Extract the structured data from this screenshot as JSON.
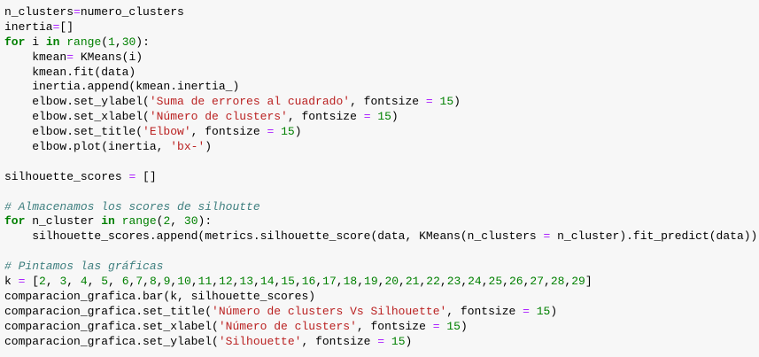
{
  "code_lines": [
    [
      [
        "tx",
        "n_clusters"
      ],
      [
        "op",
        "="
      ],
      [
        "tx",
        "numero_clusters"
      ]
    ],
    [
      [
        "tx",
        "inertia"
      ],
      [
        "op",
        "="
      ],
      [
        "tx",
        "[]"
      ]
    ],
    [
      [
        "kw",
        "for"
      ],
      [
        "tx",
        " i "
      ],
      [
        "kw",
        "in"
      ],
      [
        "tx",
        " "
      ],
      [
        "bi",
        "range"
      ],
      [
        "tx",
        "("
      ],
      [
        "num",
        "1"
      ],
      [
        "tx",
        ","
      ],
      [
        "num",
        "30"
      ],
      [
        "tx",
        "):"
      ]
    ],
    [
      [
        "tx",
        "    kmean"
      ],
      [
        "op",
        "="
      ],
      [
        "tx",
        " KMeans(i)"
      ]
    ],
    [
      [
        "tx",
        "    kmean.fit(data)"
      ]
    ],
    [
      [
        "tx",
        "    inertia.append(kmean.inertia_)"
      ]
    ],
    [
      [
        "tx",
        "    elbow.set_ylabel("
      ],
      [
        "str",
        "'Suma de errores al cuadrado'"
      ],
      [
        "tx",
        ", fontsize "
      ],
      [
        "op",
        "="
      ],
      [
        "tx",
        " "
      ],
      [
        "num",
        "15"
      ],
      [
        "tx",
        ")"
      ]
    ],
    [
      [
        "tx",
        "    elbow.set_xlabel("
      ],
      [
        "str",
        "'Número de clusters'"
      ],
      [
        "tx",
        ", fontsize "
      ],
      [
        "op",
        "="
      ],
      [
        "tx",
        " "
      ],
      [
        "num",
        "15"
      ],
      [
        "tx",
        ")"
      ]
    ],
    [
      [
        "tx",
        "    elbow.set_title("
      ],
      [
        "str",
        "'Elbow'"
      ],
      [
        "tx",
        ", fontsize "
      ],
      [
        "op",
        "="
      ],
      [
        "tx",
        " "
      ],
      [
        "num",
        "15"
      ],
      [
        "tx",
        ")"
      ]
    ],
    [
      [
        "tx",
        "    elbow.plot(inertia, "
      ],
      [
        "str",
        "'bx-'"
      ],
      [
        "tx",
        ")"
      ]
    ],
    [],
    [
      [
        "tx",
        "silhouette_scores "
      ],
      [
        "op",
        "="
      ],
      [
        "tx",
        " []"
      ]
    ],
    [],
    [
      [
        "cm",
        "# Almacenamos los scores de silhoutte"
      ]
    ],
    [
      [
        "kw",
        "for"
      ],
      [
        "tx",
        " n_cluster "
      ],
      [
        "kw",
        "in"
      ],
      [
        "tx",
        " "
      ],
      [
        "bi",
        "range"
      ],
      [
        "tx",
        "("
      ],
      [
        "num",
        "2"
      ],
      [
        "tx",
        ", "
      ],
      [
        "num",
        "30"
      ],
      [
        "tx",
        "):"
      ]
    ],
    [
      [
        "tx",
        "    silhouette_scores.append(metrics.silhouette_score(data, KMeans(n_clusters "
      ],
      [
        "op",
        "="
      ],
      [
        "tx",
        " n_cluster).fit_predict(data)))"
      ]
    ],
    [],
    [
      [
        "cm",
        "# Pintamos las gráficas"
      ]
    ],
    [
      [
        "tx",
        "k "
      ],
      [
        "op",
        "="
      ],
      [
        "tx",
        " ["
      ],
      [
        "num",
        "2"
      ],
      [
        "tx",
        ", "
      ],
      [
        "num",
        "3"
      ],
      [
        "tx",
        ", "
      ],
      [
        "num",
        "4"
      ],
      [
        "tx",
        ", "
      ],
      [
        "num",
        "5"
      ],
      [
        "tx",
        ", "
      ],
      [
        "num",
        "6"
      ],
      [
        "tx",
        ","
      ],
      [
        "num",
        "7"
      ],
      [
        "tx",
        ","
      ],
      [
        "num",
        "8"
      ],
      [
        "tx",
        ","
      ],
      [
        "num",
        "9"
      ],
      [
        "tx",
        ","
      ],
      [
        "num",
        "10"
      ],
      [
        "tx",
        ","
      ],
      [
        "num",
        "11"
      ],
      [
        "tx",
        ","
      ],
      [
        "num",
        "12"
      ],
      [
        "tx",
        ","
      ],
      [
        "num",
        "13"
      ],
      [
        "tx",
        ","
      ],
      [
        "num",
        "14"
      ],
      [
        "tx",
        ","
      ],
      [
        "num",
        "15"
      ],
      [
        "tx",
        ","
      ],
      [
        "num",
        "16"
      ],
      [
        "tx",
        ","
      ],
      [
        "num",
        "17"
      ],
      [
        "tx",
        ","
      ],
      [
        "num",
        "18"
      ],
      [
        "tx",
        ","
      ],
      [
        "num",
        "19"
      ],
      [
        "tx",
        ","
      ],
      [
        "num",
        "20"
      ],
      [
        "tx",
        ","
      ],
      [
        "num",
        "21"
      ],
      [
        "tx",
        ","
      ],
      [
        "num",
        "22"
      ],
      [
        "tx",
        ","
      ],
      [
        "num",
        "23"
      ],
      [
        "tx",
        ","
      ],
      [
        "num",
        "24"
      ],
      [
        "tx",
        ","
      ],
      [
        "num",
        "25"
      ],
      [
        "tx",
        ","
      ],
      [
        "num",
        "26"
      ],
      [
        "tx",
        ","
      ],
      [
        "num",
        "27"
      ],
      [
        "tx",
        ","
      ],
      [
        "num",
        "28"
      ],
      [
        "tx",
        ","
      ],
      [
        "num",
        "29"
      ],
      [
        "tx",
        "]"
      ]
    ],
    [
      [
        "tx",
        "comparacion_grafica.bar(k, silhouette_scores)"
      ]
    ],
    [
      [
        "tx",
        "comparacion_grafica.set_title("
      ],
      [
        "str",
        "'Número de clusters Vs Silhouette'"
      ],
      [
        "tx",
        ", fontsize "
      ],
      [
        "op",
        "="
      ],
      [
        "tx",
        " "
      ],
      [
        "num",
        "15"
      ],
      [
        "tx",
        ")"
      ]
    ],
    [
      [
        "tx",
        "comparacion_grafica.set_xlabel("
      ],
      [
        "str",
        "'Número de clusters'"
      ],
      [
        "tx",
        ", fontsize "
      ],
      [
        "op",
        "="
      ],
      [
        "tx",
        " "
      ],
      [
        "num",
        "15"
      ],
      [
        "tx",
        ")"
      ]
    ],
    [
      [
        "tx",
        "comparacion_grafica.set_ylabel("
      ],
      [
        "str",
        "'Silhouette'"
      ],
      [
        "tx",
        ", fontsize "
      ],
      [
        "op",
        "="
      ],
      [
        "tx",
        " "
      ],
      [
        "num",
        "15"
      ],
      [
        "tx",
        ")"
      ]
    ]
  ],
  "colors": {
    "background": "#f7f7f7",
    "keyword": "#008000",
    "number": "#008000",
    "operator": "#AA22FF",
    "string": "#BA2121",
    "comment": "#408080"
  }
}
